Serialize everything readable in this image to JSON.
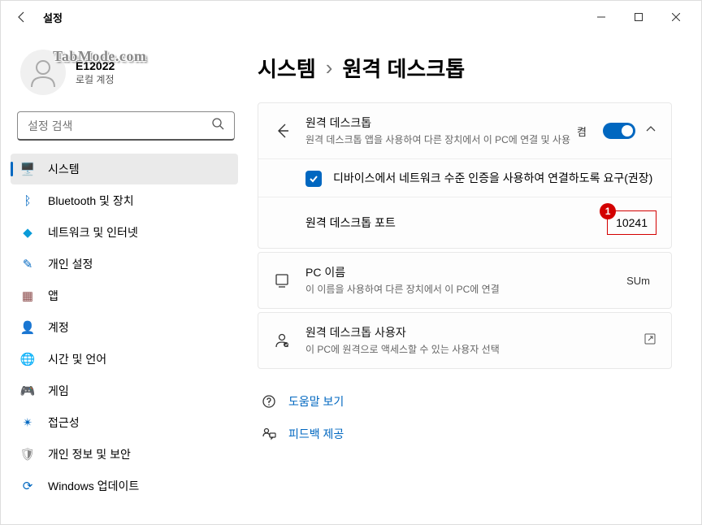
{
  "app_title": "설정",
  "watermark": "TabMode.com",
  "user": {
    "name": "E12022",
    "account_type": "로컬 계정"
  },
  "search": {
    "placeholder": "설정 검색"
  },
  "sidebar": {
    "items": [
      {
        "label": "시스템",
        "icon": "🖥️",
        "color": "#0067c0",
        "active": true
      },
      {
        "label": "Bluetooth 및 장치",
        "icon": "ᛒ",
        "color": "#0067c0"
      },
      {
        "label": "네트워크 및 인터넷",
        "icon": "◆",
        "color": "#0a9bd8"
      },
      {
        "label": "개인 설정",
        "icon": "✎",
        "color": "#0067c0"
      },
      {
        "label": "앱",
        "icon": "▦",
        "color": "#8b4a4a"
      },
      {
        "label": "계정",
        "icon": "👤",
        "color": "#c39b5a"
      },
      {
        "label": "시간 및 언어",
        "icon": "🌐",
        "color": "#555"
      },
      {
        "label": "게임",
        "icon": "🎮",
        "color": "#555"
      },
      {
        "label": "접근성",
        "icon": "✴",
        "color": "#0067c0"
      },
      {
        "label": "개인 정보 및 보안",
        "icon": "🛡",
        "color": "#888"
      },
      {
        "label": "Windows 업데이트",
        "icon": "⟳",
        "color": "#0067c0"
      }
    ]
  },
  "breadcrumb": {
    "parent": "시스템",
    "sep": "›",
    "current": "원격 데스크톱"
  },
  "remote": {
    "title": "원격 데스크톱",
    "desc": "원격 데스크톱 앱을 사용하여 다른 장치에서 이 PC에 연결 및 사용",
    "toggle_label": "켬",
    "nla_label": "디바이스에서 네트워크 수준 인증을 사용하여 연결하도록 요구(권장)",
    "port_label": "원격 데스크톱 포트",
    "port_value": "10241",
    "port_badge": "1"
  },
  "pcname": {
    "title": "PC 이름",
    "desc": "이 이름을 사용하여 다른 장치에서 이 PC에 연결",
    "value": "SUm"
  },
  "users": {
    "title": "원격 데스크톱 사용자",
    "desc": "이 PC에 원격으로 액세스할 수 있는 사용자 선택"
  },
  "links": {
    "help": "도움말 보기",
    "feedback": "피드백 제공"
  }
}
